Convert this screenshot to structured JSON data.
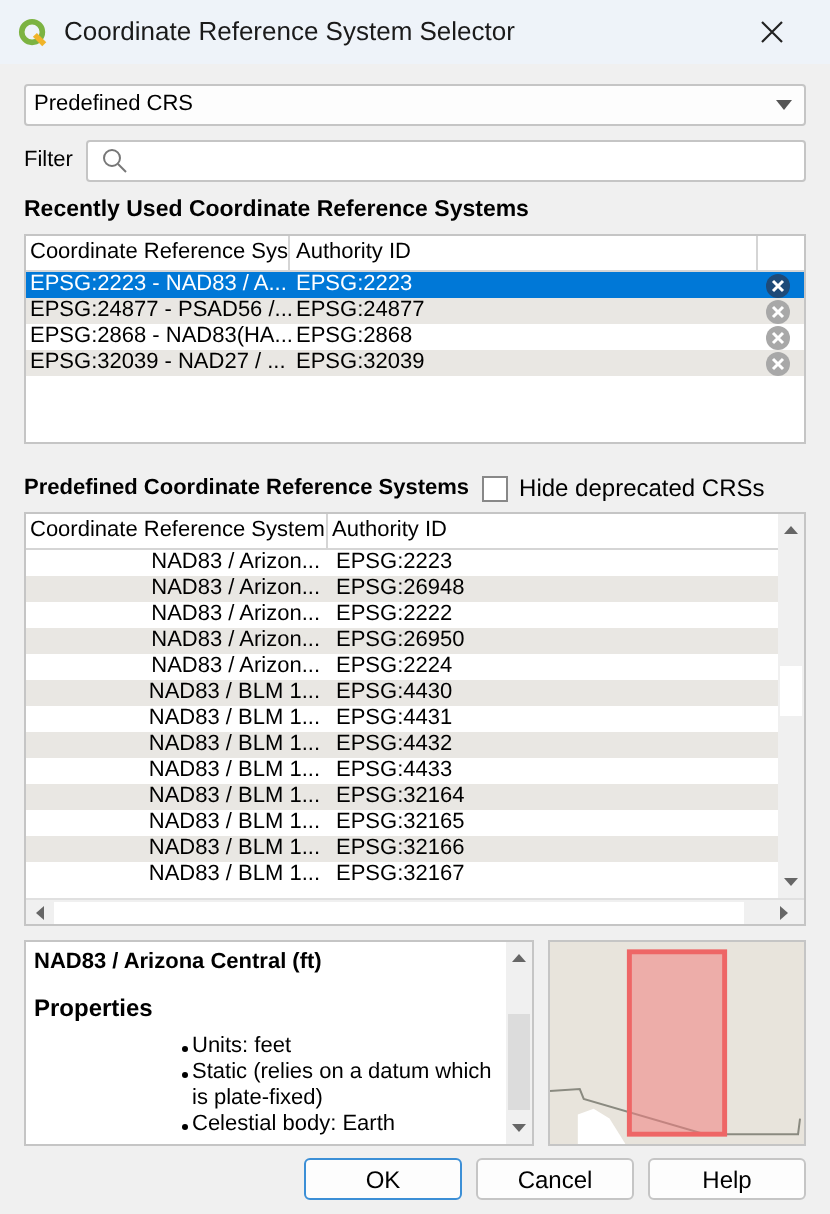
{
  "window": {
    "title": "Coordinate Reference System Selector"
  },
  "crs_type": {
    "value": "Predefined CRS"
  },
  "filter": {
    "label": "Filter"
  },
  "recent": {
    "heading": "Recently Used Coordinate Reference Systems",
    "columns": [
      "Coordinate Reference Sys",
      "Authority ID"
    ],
    "rows": [
      {
        "name": "EPSG:2223 - NAD83 / A...",
        "authority_id": "EPSG:2223",
        "selected": true
      },
      {
        "name": "EPSG:24877 - PSAD56 /...",
        "authority_id": "EPSG:24877",
        "selected": false
      },
      {
        "name": "EPSG:2868 - NAD83(HA...",
        "authority_id": "EPSG:2868",
        "selected": false
      },
      {
        "name": "EPSG:32039 - NAD27 / ...",
        "authority_id": "EPSG:32039",
        "selected": false
      }
    ]
  },
  "predefined": {
    "heading": "Predefined Coordinate Reference Systems",
    "hide_deprecated": {
      "label": "Hide deprecated CRSs",
      "checked": false
    },
    "columns": [
      "Coordinate Reference System",
      "Authority ID"
    ],
    "rows": [
      {
        "name": "NAD83 / Arizon...",
        "authority_id": "EPSG:2223"
      },
      {
        "name": "NAD83 / Arizon...",
        "authority_id": "EPSG:26948"
      },
      {
        "name": "NAD83 / Arizon...",
        "authority_id": "EPSG:2222"
      },
      {
        "name": "NAD83 / Arizon...",
        "authority_id": "EPSG:26950"
      },
      {
        "name": "NAD83 / Arizon...",
        "authority_id": "EPSG:2224"
      },
      {
        "name": "NAD83 / BLM 1...",
        "authority_id": "EPSG:4430"
      },
      {
        "name": "NAD83 / BLM 1...",
        "authority_id": "EPSG:4431"
      },
      {
        "name": "NAD83 / BLM 1...",
        "authority_id": "EPSG:4432"
      },
      {
        "name": "NAD83 / BLM 1...",
        "authority_id": "EPSG:4433"
      },
      {
        "name": "NAD83 / BLM 1...",
        "authority_id": "EPSG:32164"
      },
      {
        "name": "NAD83 / BLM 1...",
        "authority_id": "EPSG:32165"
      },
      {
        "name": "NAD83 / BLM 1...",
        "authority_id": "EPSG:32166"
      },
      {
        "name": "NAD83 / BLM 1...",
        "authority_id": "EPSG:32167"
      }
    ]
  },
  "details": {
    "title": "NAD83 / Arizona Central (ft)",
    "section": "Properties",
    "items": [
      "Units: feet",
      "Static (relies on a datum which is plate-fixed)",
      "Celestial body: Earth"
    ]
  },
  "buttons": [
    {
      "label": "OK",
      "default": true
    },
    {
      "label": "Cancel",
      "default": false
    },
    {
      "label": "Help",
      "default": false
    }
  ]
}
